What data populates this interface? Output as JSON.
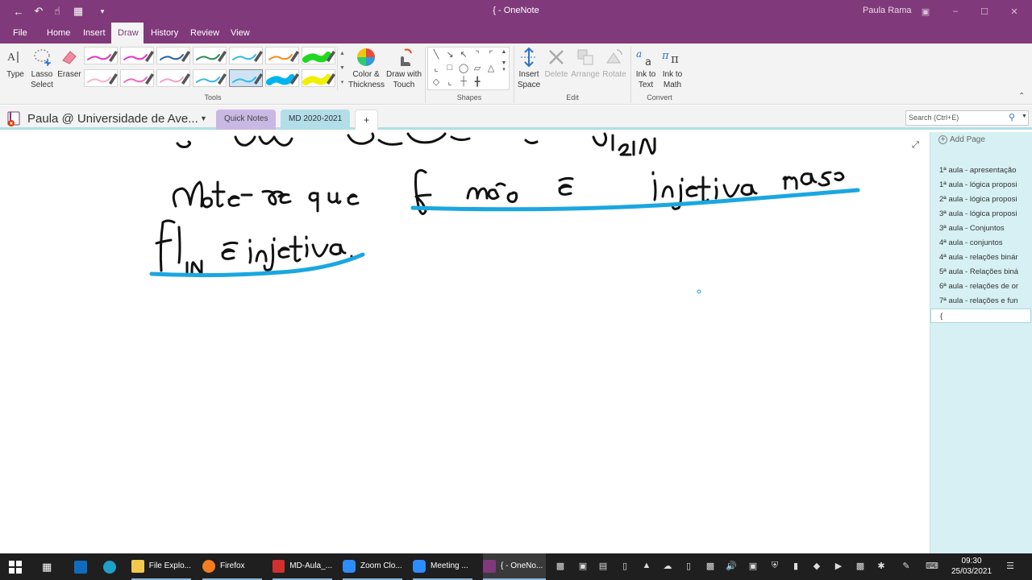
{
  "window": {
    "title": "{  -  OneNote",
    "user": "Paula Rama"
  },
  "ribbon_tabs": [
    "File",
    "Home",
    "Insert",
    "Draw",
    "History",
    "Review",
    "View"
  ],
  "active_tab": "Draw",
  "tools_group": {
    "type_label": "Type",
    "lasso_label_1": "Lasso",
    "lasso_label_2": "Select",
    "eraser_label": "Eraser",
    "label": "Tools",
    "color_thickness_1": "Color &",
    "color_thickness_2": "Thickness",
    "draw_touch_1": "Draw with",
    "draw_touch_2": "Touch",
    "pen_colors": [
      "#e633c8",
      "#e633c8",
      "#2a5fa8",
      "#2e8b57",
      "#36b8e6",
      "#f28b1a",
      "#1fd81f",
      "#f5b3c8",
      "#f06ac0",
      "#f5a0c8",
      "#36b8e6",
      "#36b8e6",
      "#00b4f0",
      "#f0f000"
    ]
  },
  "shapes_group": {
    "label": "Shapes"
  },
  "edit_group": {
    "label": "Edit",
    "insert_space_1": "Insert",
    "insert_space_2": "Space",
    "delete": "Delete",
    "arrange": "Arrange",
    "rotate": "Rotate"
  },
  "convert_group": {
    "label": "Convert",
    "ink_text_1": "Ink to",
    "ink_text_2": "Text",
    "ink_math_1": "Ink to",
    "ink_math_2": "Math"
  },
  "notebook": {
    "name": "Paula @ Universidade de Ave...",
    "sections": [
      "Quick Notes",
      "MD 2020-2021"
    ],
    "add_section": "+",
    "search_placeholder": "Search (Ctrl+E)"
  },
  "pages": {
    "add_page": "Add Page",
    "items": [
      "1ª aula - apresentação",
      "1ª aula - lógica proposi",
      "2ª aula - lógica proposi",
      "3ª aula - lógica proposi",
      "3ª aula - Conjuntos",
      "4ª aula - conjuntos",
      "4ª aula - relações binár",
      "5ª aula - Relações biná",
      "6ª aula - relações de or",
      "7ª aula - relações e fun",
      "{"
    ]
  },
  "taskbar": {
    "apps": [
      "File Explo...",
      "Firefox",
      "MD-Aula_...",
      "Zoom Clo...",
      "Meeting ...",
      "{ - OneNo..."
    ],
    "time": "09:30",
    "date": "25/03/2021"
  },
  "colors": {
    "brand": "#80397b",
    "highlight_ink": "#1aa7e0",
    "page_list_bg": "#d6f0f3"
  }
}
